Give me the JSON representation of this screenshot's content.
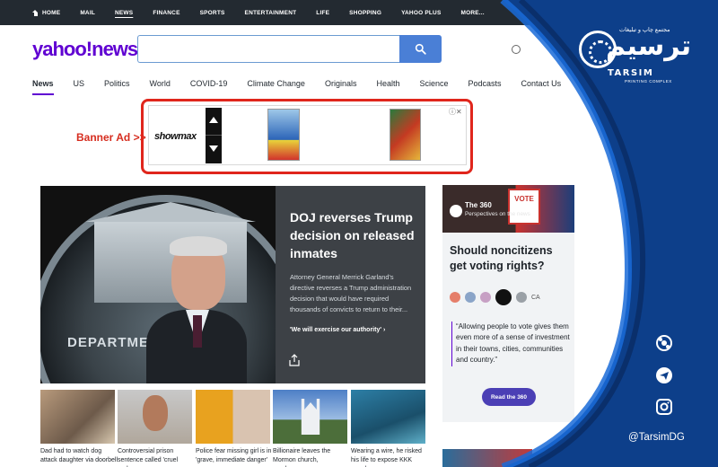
{
  "topnav": {
    "items": [
      "HOME",
      "MAIL",
      "NEWS",
      "FINANCE",
      "SPORTS",
      "ENTERTAINMENT",
      "LIFE",
      "SHOPPING",
      "YAHOO PLUS",
      "MORE..."
    ],
    "active": "NEWS"
  },
  "logo": {
    "brand": "yahoo!",
    "section": "news"
  },
  "search": {
    "placeholder": ""
  },
  "catnav": {
    "items": [
      "News",
      "US",
      "Politics",
      "World",
      "COVID-19",
      "Climate Change",
      "Originals",
      "Health",
      "Science",
      "Podcasts",
      "Contact Us"
    ],
    "more": "..."
  },
  "banner": {
    "label": "Banner Ad >>",
    "advertiser": "showmax",
    "ad_choice": "ⓘ✕"
  },
  "hero": {
    "image_text": "DEPARTMENT       STICE",
    "title": "DOJ reverses Trump decision on released inmates",
    "description": "Attorney General Merrick Garland's directive reverses a Trump administration decision that would have required thousands of convicts to return to their...",
    "link": "'We will exercise our authority' ›"
  },
  "thumbnails": [
    {
      "caption": "Dad had to watch dog attack daughter via doorbell cam"
    },
    {
      "caption": "Controversial prison sentence called 'cruel and..."
    },
    {
      "caption": "Police fear missing girl is in 'grave, immediate danger'"
    },
    {
      "caption": "Billionaire leaves the Mormon church, condemn..."
    },
    {
      "caption": "Wearing a wire, he risked his life to expose KKK members"
    }
  ],
  "card360": {
    "label": "The 360",
    "subtitle": "Perspectives on the news",
    "sign": "VOTE",
    "question": "Should noncitizens get voting rights?",
    "source_badge": "CA",
    "quote": "“Allowing people to vote gives them even more of a sense of investment in their towns, cities, communities and country.”",
    "button": "Read the 360"
  },
  "watermark": {
    "brand_fa": "ترسیم",
    "brand_fa_sub": "مجتمع چاپ و تبلیغات",
    "brand_en": "TARSIM",
    "brand_en_sub": "PRINTING COMPLEX",
    "handle": "@TarsimDG",
    "color": "#0d3f8a"
  },
  "colors": {
    "yahoo_purple": "#6001d2",
    "ad_highlight": "#e0261c",
    "search_blue": "#4a7fd6"
  }
}
